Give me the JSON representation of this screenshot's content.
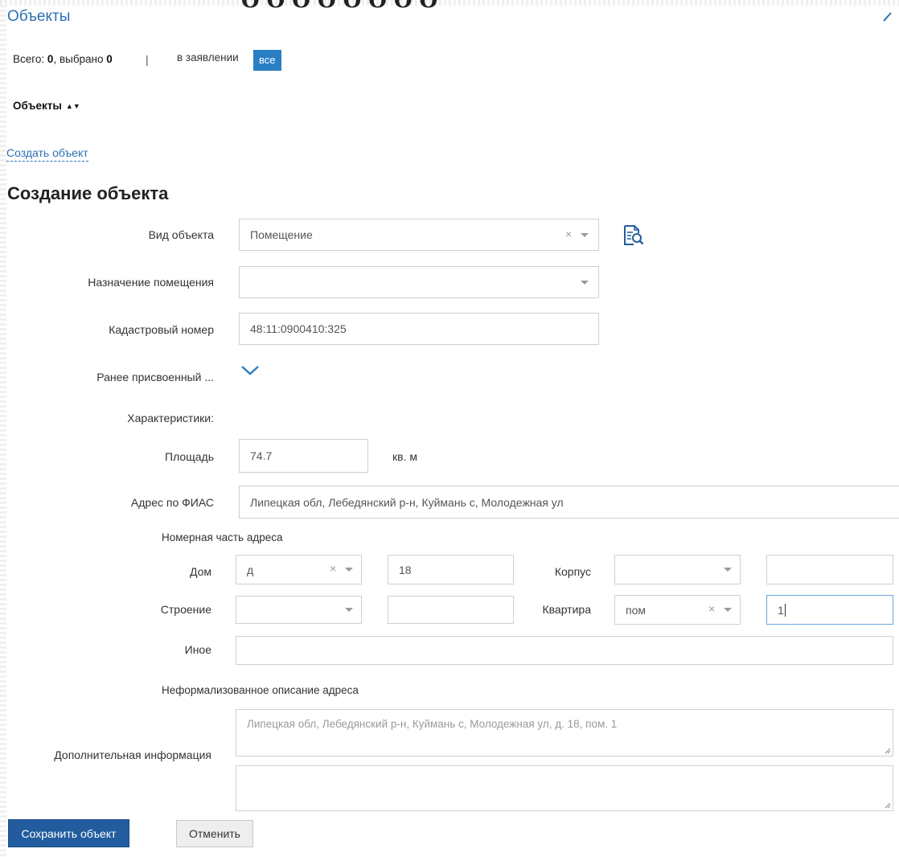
{
  "header": {
    "top_cut_text": "ОООООООО",
    "section_title": "Объекты"
  },
  "summary": {
    "total_label": "Всего:",
    "total_value": "0",
    "selected_label": ", выбрано",
    "selected_value": "0",
    "separator": "|",
    "in_application_label": "в заявлении",
    "all_button": "все"
  },
  "list": {
    "sort_header": "Объекты",
    "sort_arrows": "▲▼",
    "create_link": "Создать объект"
  },
  "form": {
    "title": "Создание объекта",
    "object_type": {
      "label": "Вид объекта",
      "value": "Помещение",
      "clear": "×"
    },
    "room_purpose": {
      "label": "Назначение помещения",
      "value": ""
    },
    "cadastral": {
      "label": "Кадастровый номер",
      "value": "48:11:0900410:325"
    },
    "previous": {
      "label": "Ранее присвоенный ..."
    },
    "characteristics_label": "Характеристики:",
    "area": {
      "label": "Площадь",
      "value": "74.7",
      "unit": "кв. м"
    },
    "fias": {
      "label": "Адрес по ФИАС",
      "value": "Липецкая обл, Лебедянский р-н, Куймань с, Молодежная ул"
    },
    "number_part_title": "Номерная часть адреса",
    "house": {
      "label": "Дом",
      "type_value": "д",
      "clear": "×",
      "number": "18"
    },
    "building": {
      "label": "Корпус",
      "type_value": "",
      "number": ""
    },
    "structure": {
      "label": "Строение",
      "type_value": "",
      "number": ""
    },
    "apartment": {
      "label": "Квартира",
      "type_value": "пом",
      "clear": "×",
      "number": "1"
    },
    "other": {
      "label": "Иное",
      "value": ""
    },
    "informal_title": "Неформализованное описание адреса",
    "informal_placeholder": "Липецкая обл, Лебедянский р-н, Куймань с, Молодежная ул, д. 18, пом. 1",
    "additional": {
      "label": "Дополнительная информация",
      "value": ""
    }
  },
  "actions": {
    "save": "Сохранить объект",
    "cancel": "Отменить"
  },
  "colors": {
    "link_blue": "#2a6fb3",
    "accent_blue": "#2a7fc4",
    "primary_button": "#225c9e",
    "active_border": "#66a6e0"
  },
  "icons": [
    "collapse-chevron-icon",
    "document-search-icon",
    "expand-chevron-down-icon",
    "dropdown-caret-icon",
    "clear-x-icon",
    "resize-grip-icon"
  ]
}
